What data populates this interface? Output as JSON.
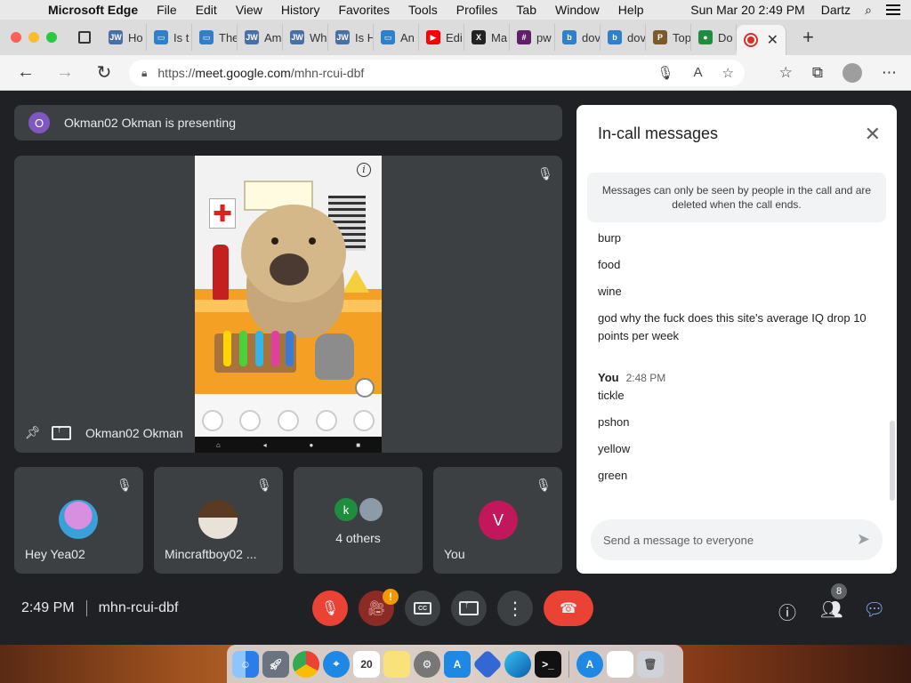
{
  "menubar": {
    "app_name": "Microsoft Edge",
    "menus": [
      "File",
      "Edit",
      "View",
      "History",
      "Favorites",
      "Tools",
      "Profiles",
      "Tab",
      "Window",
      "Help"
    ],
    "clock": "Sun Mar 20  2:49 PM",
    "user": "Dartz"
  },
  "tabs": [
    {
      "label": "Ho",
      "icon": "JW",
      "color": "#4a6fa5"
    },
    {
      "label": "Is t",
      "icon": "doc",
      "color": "#2f80c8"
    },
    {
      "label": "The",
      "icon": "doc",
      "color": "#2f80c8"
    },
    {
      "label": "Am",
      "icon": "JW",
      "color": "#4a6fa5"
    },
    {
      "label": "Wh",
      "icon": "JW",
      "color": "#4a6fa5"
    },
    {
      "label": "Is H",
      "icon": "JW",
      "color": "#4a6fa5"
    },
    {
      "label": "An",
      "icon": "doc",
      "color": "#2f80c8"
    },
    {
      "label": "Edi",
      "icon": "▶",
      "color": "#ff0000"
    },
    {
      "label": "Ma",
      "icon": "X",
      "color": "#222222"
    },
    {
      "label": "pw",
      "icon": "#",
      "color": "#611f69"
    },
    {
      "label": "dov",
      "icon": "b",
      "color": "#2f80c8"
    },
    {
      "label": "dov",
      "icon": "b",
      "color": "#2f80c8"
    },
    {
      "label": "Top",
      "icon": "P",
      "color": "#7a5a2a"
    },
    {
      "label": "Do",
      "icon": "●",
      "color": "#1e8e3e"
    }
  ],
  "address": {
    "url_prefix": "https://",
    "url_host": "meet.google.com",
    "url_path": "/mhn-rcui-dbf"
  },
  "meet": {
    "presenter_initial": "O",
    "presenting_text": "Okman02 Okman is presenting",
    "main_tile_name": "Okman02 Okman",
    "participants": [
      {
        "name": "Hey Yea02"
      },
      {
        "name": "Mincraftboy02 ..."
      },
      {
        "name": "4 others",
        "initial": "k"
      },
      {
        "name": "You",
        "initial": "V"
      }
    ],
    "time": "2:49 PM",
    "meeting_code": "mhn-rcui-dbf",
    "people_count": "8"
  },
  "chat": {
    "title": "In-call messages",
    "notice": "Messages can only be seen by people in the call and are deleted when the call ends.",
    "messages_before": [
      "burp",
      "food",
      "wine",
      "god why the fuck does this site's average IQ drop 10 points per week"
    ],
    "sender": "You",
    "sender_time": "2:48 PM",
    "messages_after": [
      "tickle",
      "pshon",
      "yellow",
      "green"
    ],
    "input_placeholder": "Send a message to everyone"
  }
}
